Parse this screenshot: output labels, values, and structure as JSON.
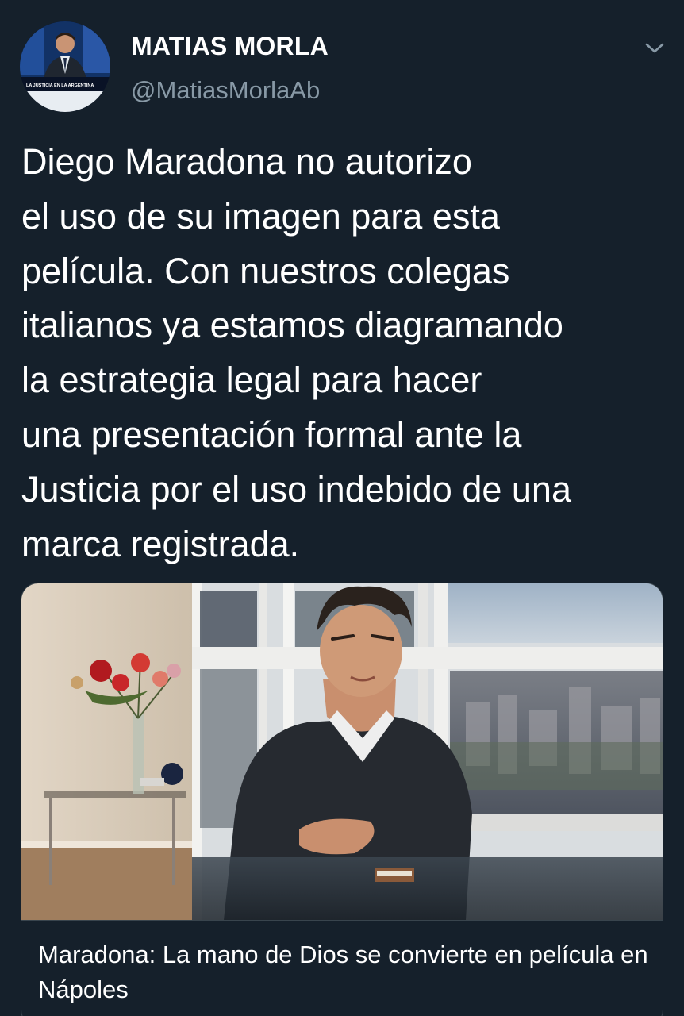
{
  "user": {
    "display_name": "MATIAS MORLA",
    "handle": "@MatiasMorlaAb",
    "avatar_caption": "LA JUSTICIA EN LA ARGENTINA"
  },
  "tweet": {
    "text": "Diego Maradona no autorizo\nel uso de su imagen para esta\npelícula. Con nuestros colegas\nitalianos ya estamos diagramando\nla estrategia legal para hacer\nuna presentación formal ante la\nJusticia por el uso indebido de una\nmarca registrada."
  },
  "card": {
    "title": "Maradona: La mano de Dios se convierte en película en Nápoles"
  },
  "icons": {
    "menu": "chevron-down-icon"
  },
  "colors": {
    "background": "#15202b",
    "secondary_text": "#8899a6",
    "border": "#38444d"
  }
}
